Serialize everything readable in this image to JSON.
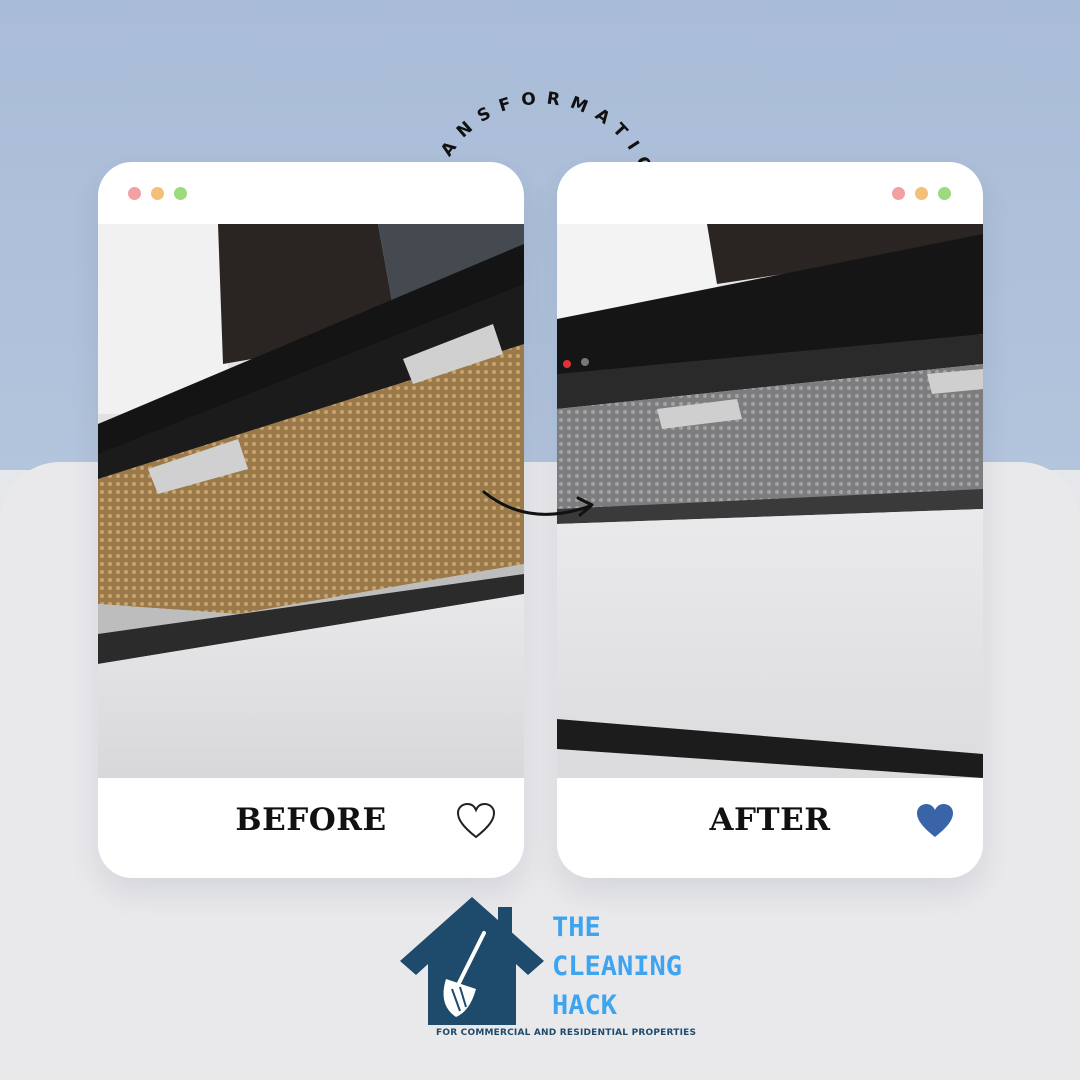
{
  "header": {
    "arc_text": "TRANSFORMATION"
  },
  "window_dots": {
    "red": "#f2a0a4",
    "yellow": "#f2c079",
    "green": "#9bdb7e"
  },
  "cards": {
    "before": {
      "label": "BEFORE",
      "heart": "heart-outline-icon"
    },
    "after": {
      "label": "AFTER",
      "heart": "heart-filled-icon",
      "heart_color": "#3a64a8"
    }
  },
  "brand": {
    "line1": "THE",
    "line2": "CLEANING",
    "line3": "HACK",
    "tagline": "FOR COMMERCIAL AND RESIDENTIAL PROPERTIES",
    "text_color": "#3fa4f0",
    "house_color": "#1e4a6b"
  }
}
